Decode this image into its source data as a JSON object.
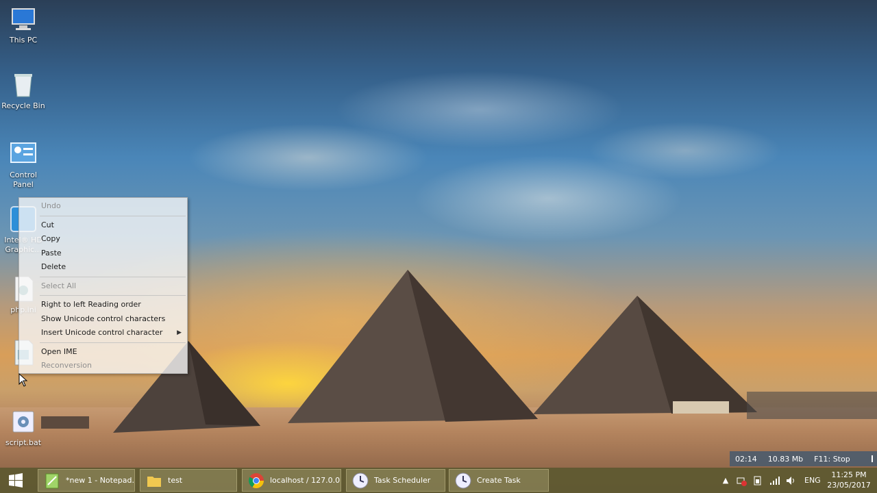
{
  "desktop": {
    "icons": [
      {
        "label": "This PC",
        "icon": "computer-icon"
      },
      {
        "label": "Recycle Bin",
        "icon": "recycle-bin-icon"
      },
      {
        "label": "Control Panel",
        "icon": "control-panel-icon"
      },
      {
        "label": "Intel® HD Graphic...",
        "icon": "intel-graphics-icon"
      },
      {
        "label": "php.ini",
        "icon": "settings-file-icon"
      },
      {
        "label": "",
        "icon": "shortcut-file-icon"
      },
      {
        "label": "script.bat",
        "icon": "batch-file-icon"
      }
    ]
  },
  "context_menu": {
    "items": [
      {
        "label": "Undo",
        "disabled": true
      },
      {
        "separator": true
      },
      {
        "label": "Cut",
        "disabled": false
      },
      {
        "label": "Copy",
        "disabled": false
      },
      {
        "label": "Paste",
        "disabled": false
      },
      {
        "label": "Delete",
        "disabled": false
      },
      {
        "separator": true
      },
      {
        "label": "Select All",
        "disabled": true
      },
      {
        "separator": true
      },
      {
        "label": "Right to left Reading order",
        "disabled": false
      },
      {
        "label": "Show Unicode control characters",
        "disabled": false
      },
      {
        "label": "Insert Unicode control character",
        "disabled": false,
        "submenu": true
      },
      {
        "separator": true
      },
      {
        "label": "Open IME",
        "disabled": false
      },
      {
        "label": "Reconversion",
        "disabled": true
      }
    ]
  },
  "recorder": {
    "elapsed": "02:14",
    "size": "10.83 Mb",
    "stop_hint": "F11: Stop"
  },
  "taskbar": {
    "buttons": [
      {
        "label": "*new 1 - Notepad...",
        "icon": "notepadpp-icon"
      },
      {
        "label": "test",
        "icon": "folder-icon"
      },
      {
        "label": "localhost / 127.0.0...",
        "icon": "chrome-icon"
      },
      {
        "label": "Task Scheduler",
        "icon": "task-scheduler-icon"
      },
      {
        "label": "Create Task",
        "icon": "task-scheduler-icon"
      }
    ],
    "tray": {
      "language": "ENG",
      "time": "11:25 PM",
      "date": "23/05/2017"
    }
  },
  "colors": {
    "taskbar": "#5c5830",
    "menu_bg": "#f8f8f8",
    "disabled_text": "#8f8f8f"
  }
}
